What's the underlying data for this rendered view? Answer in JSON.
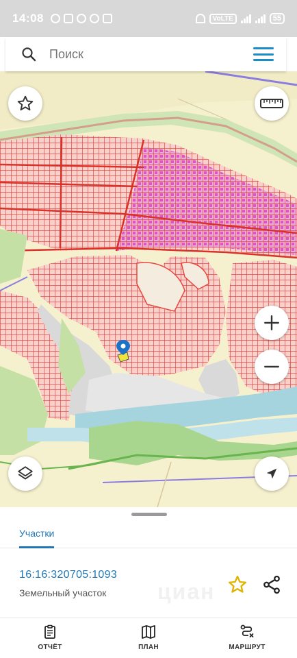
{
  "status_bar": {
    "time": "14:08",
    "battery": "55",
    "network_tag": "VoLTE"
  },
  "search": {
    "placeholder": "Поиск"
  },
  "map": {
    "buttons": [
      "favorites",
      "ruler",
      "zoom-in",
      "zoom-out",
      "layers",
      "my-location"
    ],
    "colors": {
      "parcel_outline": "#e8473f",
      "parcel_fill": "#f6c8c2",
      "zone_magenta": "#d64bbd",
      "river": "#a5d4df",
      "forest": "#b9dc9b",
      "ground": "#f5f0cd"
    }
  },
  "sheet": {
    "tab_label": "Участки",
    "cadastral_number": "16:16:320705:1093",
    "parcel_type": "Земельный участок",
    "watermark": "циан"
  },
  "bottom_nav": {
    "report": "ОТЧЁТ",
    "plan": "ПЛАН",
    "route": "МАРШРУТ"
  },
  "accent_color": "#2077b6"
}
